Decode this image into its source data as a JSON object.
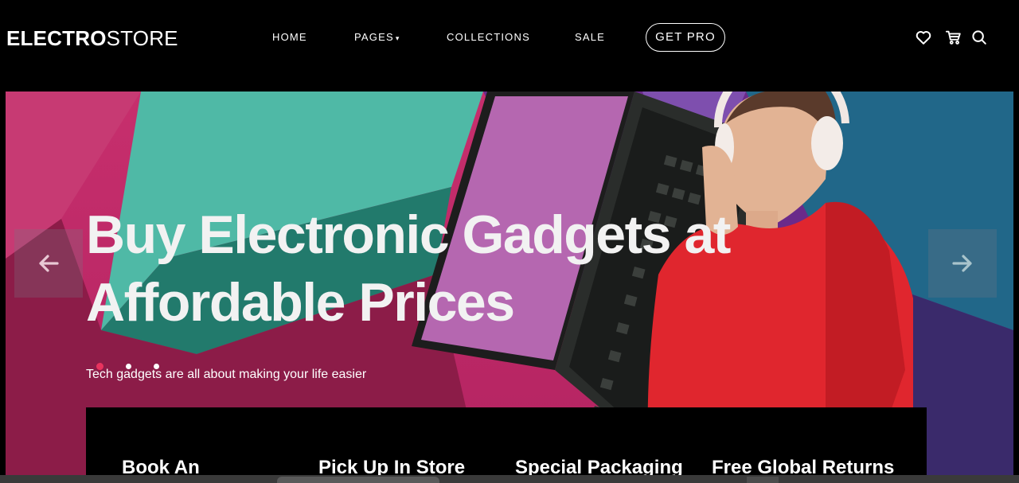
{
  "brand": {
    "bold": "ELECTRO",
    "light": "STORE"
  },
  "nav": {
    "items": [
      {
        "label": "HOME"
      },
      {
        "label": "PAGES"
      },
      {
        "label": "COLLECTIONS"
      },
      {
        "label": "SALE"
      }
    ],
    "pages_caret": "▾",
    "cta_label": "GET PRO",
    "icons": [
      "heart-icon",
      "cart-icon",
      "search-icon"
    ]
  },
  "hero": {
    "headline_line1": "Buy Electronic Gadgets at",
    "headline_line2": "Affordable Prices",
    "subheadline": "Tech gadgets are all about making your life easier",
    "slide_count": 3,
    "active_slide": 1,
    "arrow_icons": [
      "arrow-left-icon",
      "arrow-right-icon"
    ]
  },
  "features": [
    {
      "title": "Book An"
    },
    {
      "title": "Pick Up In Store"
    },
    {
      "title": "Special Packaging"
    },
    {
      "title": "Free Global Returns"
    }
  ],
  "colors": {
    "background": "#000000",
    "hero_pink": "#c72f6d",
    "accent_dot": "#e8335e",
    "sweater_red": "#e0262e"
  }
}
